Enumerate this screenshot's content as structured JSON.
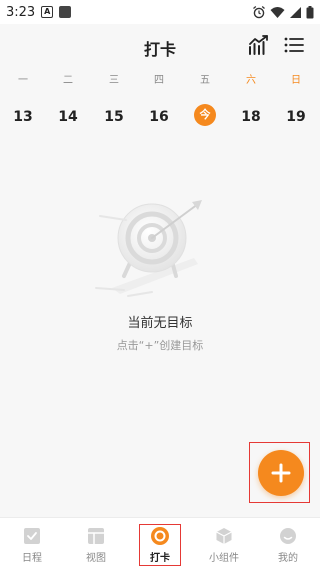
{
  "status_bar": {
    "time": "3:23",
    "left_icons": [
      "a-icon",
      "square-icon"
    ],
    "right_icons": [
      "alarm-icon",
      "wifi-icon",
      "signal-icon",
      "battery-icon"
    ]
  },
  "header": {
    "title": "打卡",
    "icons": [
      "trend-chart-icon",
      "list-menu-icon"
    ]
  },
  "week": {
    "days": [
      {
        "name": "一",
        "date": "13",
        "is_today": false,
        "weekend": false
      },
      {
        "name": "二",
        "date": "14",
        "is_today": false,
        "weekend": false
      },
      {
        "name": "三",
        "date": "15",
        "is_today": false,
        "weekend": false
      },
      {
        "name": "四",
        "date": "16",
        "is_today": false,
        "weekend": false
      },
      {
        "name": "五",
        "date": "今",
        "is_today": true,
        "weekend": false
      },
      {
        "name": "六",
        "date": "18",
        "is_today": false,
        "weekend": true
      },
      {
        "name": "日",
        "date": "19",
        "is_today": false,
        "weekend": true
      }
    ]
  },
  "empty_state": {
    "title": "当前无目标",
    "subtitle": "点击“+”创建目标"
  },
  "fab": {
    "icon": "plus-icon"
  },
  "bottom_nav": {
    "items": [
      {
        "label": "日程",
        "icon": "check-square-icon",
        "active": false
      },
      {
        "label": "视图",
        "icon": "layout-icon",
        "active": false
      },
      {
        "label": "打卡",
        "icon": "target-icon",
        "active": true
      },
      {
        "label": "小组件",
        "icon": "cube-icon",
        "active": false
      },
      {
        "label": "我的",
        "icon": "smile-face-icon",
        "active": false
      }
    ]
  },
  "colors": {
    "accent": "#f5891e",
    "highlight_outline": "#e53935",
    "background": "#f7f7f7",
    "inactive_icon": "#cfcfcf"
  }
}
